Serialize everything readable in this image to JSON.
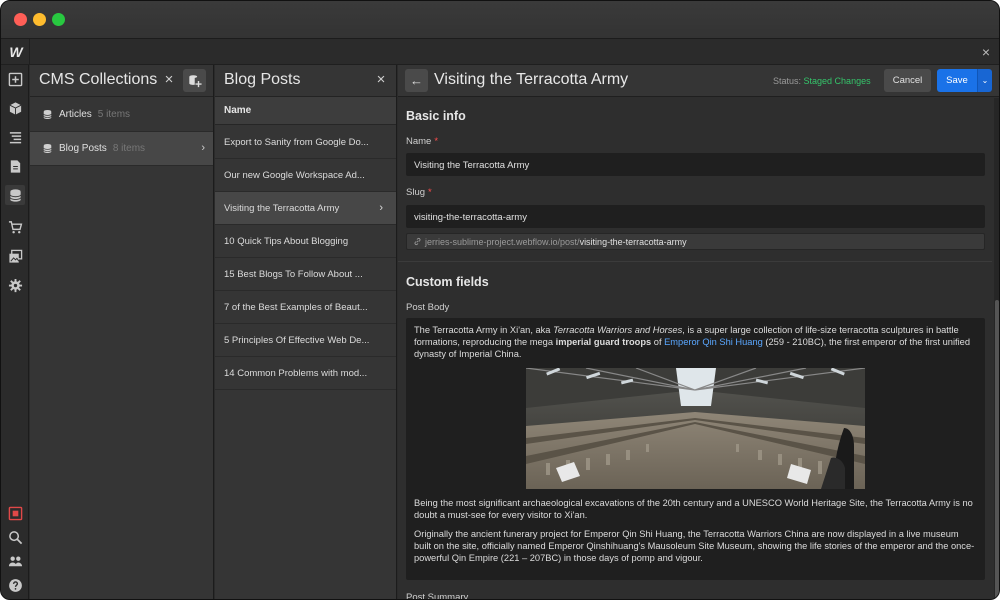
{
  "window": {
    "controls": [
      "close",
      "minimize",
      "zoom"
    ]
  },
  "topbar": {
    "logo_text": "W",
    "close_icon": "×"
  },
  "rail": {
    "icons": [
      "add-panel-icon",
      "components-icon",
      "navigator-icon",
      "pages-icon",
      "cms-icon",
      "ecommerce-icon",
      "assets-icon",
      "settings-icon",
      "record-icon",
      "search-icon",
      "users-icon",
      "help-icon"
    ]
  },
  "collections": {
    "title": "CMS Collections",
    "close_icon": "×",
    "items": [
      {
        "label": "Articles",
        "count": "5 items"
      },
      {
        "label": "Blog Posts",
        "count": "8 items"
      }
    ],
    "chevron": "›"
  },
  "posts": {
    "title": "Blog Posts",
    "close_icon": "×",
    "column_header": "Name",
    "chevron": "›",
    "rows": [
      "Export to Sanity from Google Do...",
      "Our new Google Workspace Ad...",
      "Visiting the Terracotta Army",
      "10 Quick Tips About Blogging",
      "15 Best Blogs To Follow About ...",
      "7 of the Best Examples of Beaut...",
      "5 Principles Of Effective Web De...",
      "14 Common Problems with mod..."
    ]
  },
  "editor": {
    "back_icon": "←",
    "title": "Visiting the Terracotta Army",
    "status_label": "Status:",
    "status_value": "Staged Changes",
    "cancel_label": "Cancel",
    "save_label": "Save",
    "save_caret": "⌄",
    "basic_info_title": "Basic info",
    "name_label": "Name",
    "name_value": "Visiting the Terracotta Army",
    "slug_label": "Slug",
    "slug_value": "visiting-the-terracotta-army",
    "required_mark": "*",
    "url_prefix": "jerries-sublime-project.webflow.io/post/",
    "url_slug": "visiting-the-terracotta-army",
    "custom_fields_title": "Custom fields",
    "post_body_label": "Post Body",
    "body": {
      "p1_a": "The Terracotta Army in Xi'an, aka ",
      "p1_italic": "Terracotta Warriors and Horses",
      "p1_b": ", is a super large collection of life-size terracotta sculptures in battle formations, reproducing the mega ",
      "p1_bold": "imperial guard troops",
      "p1_c": " of ",
      "p1_link": "Emperor Qin Shi Huang",
      "p1_d": " (259 - 210BC), the first emperor of the first unified dynasty of Imperial China.",
      "p2": "Being the most significant archaeological excavations of the 20th century and a UNESCO World Heritage Site, the Terracotta Army is no doubt a must-see for every visitor to Xi'an.",
      "p3": "Originally the ancient funerary project for Emperor Qin Shi Huang, the Terracotta Warriors China are now displayed in a live museum built on the site, officially named Emperor Qinshihuang's Mausoleum Site Museum, showing the life stories of the emperor and the once-powerful Qin Empire (221 – 207BC) in those days of pomp and vigour."
    },
    "post_summary_label": "Post Summary"
  },
  "colors": {
    "accent": "#1a72e8",
    "staged": "#35c46a",
    "required": "#ff4d4d",
    "link": "#5aa7ff"
  }
}
